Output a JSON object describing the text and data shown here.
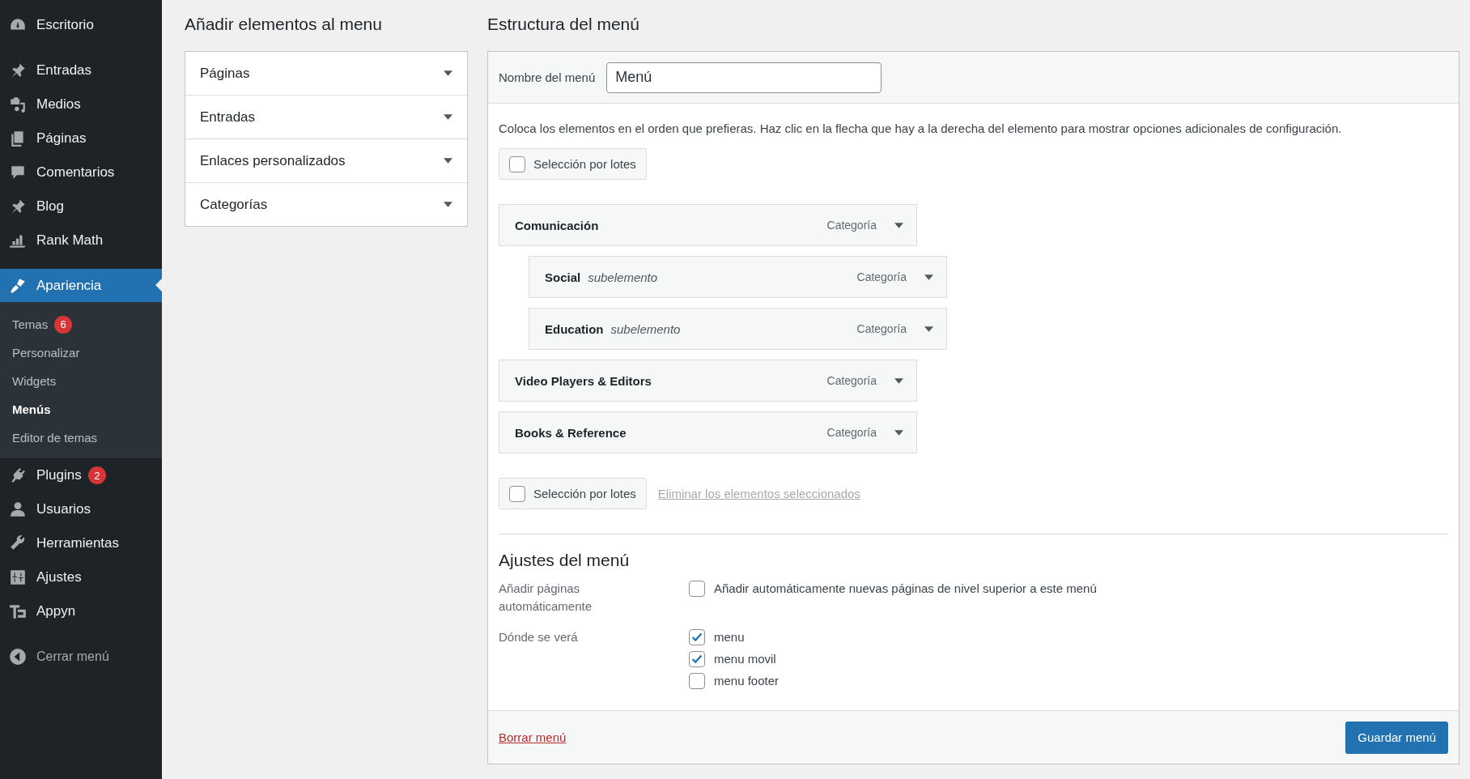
{
  "sidebar": {
    "groups": [
      {
        "items": [
          {
            "label": "Escritorio",
            "selected": false
          }
        ]
      },
      {
        "items": [
          {
            "label": "Entradas",
            "selected": false
          },
          {
            "label": "Medios",
            "selected": false
          },
          {
            "label": "Páginas",
            "selected": false
          },
          {
            "label": "Comentarios",
            "selected": false
          },
          {
            "label": "Blog",
            "selected": false
          },
          {
            "label": "Rank Math",
            "selected": false
          }
        ]
      },
      {
        "items": [
          {
            "label": "Apariencia",
            "selected": true,
            "submenu": [
              {
                "label": "Temas",
                "badge": "6",
                "selected": false
              },
              {
                "label": "Personalizar",
                "selected": false
              },
              {
                "label": "Widgets",
                "selected": false
              },
              {
                "label": "Menús",
                "selected": true
              },
              {
                "label": "Editor de temas",
                "selected": false
              }
            ]
          },
          {
            "label": "Plugins",
            "selected": false,
            "badge": "2"
          },
          {
            "label": "Usuarios",
            "selected": false
          },
          {
            "label": "Herramientas",
            "selected": false
          },
          {
            "label": "Ajustes",
            "selected": false
          },
          {
            "label": "Appyn",
            "selected": false
          }
        ]
      }
    ],
    "collapse_button": "Cerrar menú"
  },
  "add_items": {
    "title": "Añadir elementos al menu",
    "sections": [
      {
        "label": "Páginas",
        "expanded": false
      },
      {
        "label": "Entradas",
        "expanded": false
      },
      {
        "label": "Enlaces personalizados",
        "expanded": false
      },
      {
        "label": "Categorías",
        "expanded": false
      }
    ]
  },
  "structure": {
    "title": "Estructura del menú",
    "name_label": "Nombre del menú",
    "name_value": "Menú",
    "description": "Coloca los elementos en el orden que prefieras. Haz clic en la flecha que hay a la derecha del elemento para mostrar opciones adicionales de configuración.",
    "bulk_select_top": {
      "label": "Selección por lotes",
      "checked": false
    },
    "items": [
      {
        "title": "Comunicación",
        "type": "Categoría",
        "children": [
          {
            "title": "Social",
            "note": "subelemento",
            "type": "Categoría"
          },
          {
            "title": "Education",
            "note": "subelemento",
            "type": "Categoría"
          }
        ]
      },
      {
        "title": "Video Players & Editors",
        "type": "Categoría"
      },
      {
        "title": "Books & Reference",
        "type": "Categoría"
      }
    ],
    "bulk_select_bottom": {
      "label": "Selección por lotes",
      "checked": false
    },
    "remove_selected": "Eliminar los elementos seleccionados",
    "settings": {
      "title": "Ajustes del menú",
      "auto_add_label": "Añadir páginas automáticamente",
      "auto_add": {
        "label": "Añadir automáticamente nuevas páginas de nivel superior a este menú",
        "checked": false
      },
      "locations_label": "Dónde se verá",
      "locations": [
        {
          "label": "menu",
          "checked": true
        },
        {
          "label": "menu movil",
          "checked": true
        },
        {
          "label": "menu footer",
          "checked": false
        }
      ]
    },
    "delete_link": "Borrar menú",
    "save_button": "Guardar menú"
  }
}
